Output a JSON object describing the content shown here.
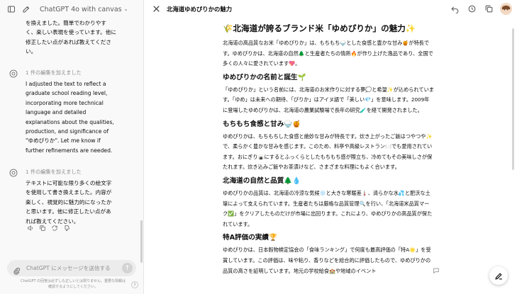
{
  "sidebar": {
    "app_title": "ChatGPT 4o with canvas",
    "messages": [
      {
        "type": "assistant",
        "text": "を換えました。簡単でわかりやすく、楽しい表現を使っています。他に修正したい点があれば教えてください。"
      },
      {
        "type": "assistant",
        "meta": "1 件の編集を加えました",
        "text": "I adjusted the text to reflect a graduate school reading level, incorporating more technical language and detailed explanations about the qualities, production, and significance of \"ゆめぴりか\". Let me know if further refinements are needed."
      },
      {
        "type": "assistant",
        "meta": "1 件の編集を加えました",
        "text": "テキストに可能な限り多くの絵文字を使用して書き換えました。内容が楽しく、視覚的に魅力的になったかと思います。他に修正したい点があれば教えてください。"
      }
    ],
    "composer_placeholder": "ChatGPT にメッセージを送信する",
    "disclaimer": "ChatGPT の回答は必ずしも正しいとは限りません。重要な情報は確認するようにしてください。",
    "help": "?"
  },
  "canvas": {
    "title": "北海道ゆめぴりかの魅力",
    "heading": "🌾北海道が誇るブランド米「ゆめぴりか」の魅力✨",
    "intro": "北海道の高品質なお米「ゆめぴりか」は、もちもち🍚とした食感と豊かな甘み🍯が特長です。ゆめぴりかは、北海道の自然🌲と生産者たちの情熱🔥が作り上げた逸品であり、全国で多くの人々に愛されています💖。",
    "sections": [
      {
        "heading": "ゆめぴりかの名前と誕生🌱",
        "body": "「ゆめぴりか」という名前には、北海道のお米作りに対する夢💭と希望✨が込められています。「ゆめ」は未来への期待、「ぴりか」はアイヌ語で「美しい💎」を意味します。2009年に登場したゆめぴりかは、北海道の農業試験場で長年の研究🧪を経て開発されました。"
      },
      {
        "heading": "もちもち食感と甘み🍚🍯",
        "body": "ゆめぴりかは、もちもちした食感と絶妙な甘みが特長です。炊き上がったご飯はつやつや✨で、柔らかく豊かな甘みを感じます。このため、料亭や高級レストラン🍽️でも愛用されています。おにぎり🍙にするとふっくらとしたもちもち感が際立ち、冷めてもその美味しさが保たれます。炊き込みご飯やお茶漬けなど、さまざまな料理にもよく合います。"
      },
      {
        "heading": "北海道の自然と品質🌲💧",
        "body": "ゆめぴりかの品質は、北海道の冷涼な気候❄️と大きな寒暖差🌡️、清らかな水💦と肥沃な土壌によって支えられています。生産者たちは厳格な品質管理🔍を行い、「北海道米品質マーク✅」をクリアしたものだけが市場に出回ります。これにより、ゆめぴりかの高品質が保たれています。"
      },
      {
        "heading": "特A評価の実績🏆",
        "body": "ゆめぴりかは、日本穀物検定協会の「食味ランキング」で何度も最高評価の「特A🌟」を受賞しています。この評価は、味や粘り、香りなどを総合的に評価したもので、ゆめぴりかの品質の高さを証明しています。地元の学校給食🏫や地域のイベント"
      }
    ]
  },
  "colors": {
    "sidebar_bg": "#f9f9f9",
    "text": "#0d0d0d",
    "muted": "#8f8f8f",
    "composer_bg": "#ececec"
  },
  "icons": [
    "sidebar-toggle-icon",
    "new-chat-icon",
    "chatgpt-logo-icon",
    "copy-icon",
    "speaker-icon",
    "thumbs-down-icon",
    "regenerate-icon",
    "attach-icon",
    "send-icon",
    "close-icon",
    "undo-icon",
    "redo-icon",
    "history-icon",
    "edit-suggest-icon",
    "comment-icon"
  ]
}
